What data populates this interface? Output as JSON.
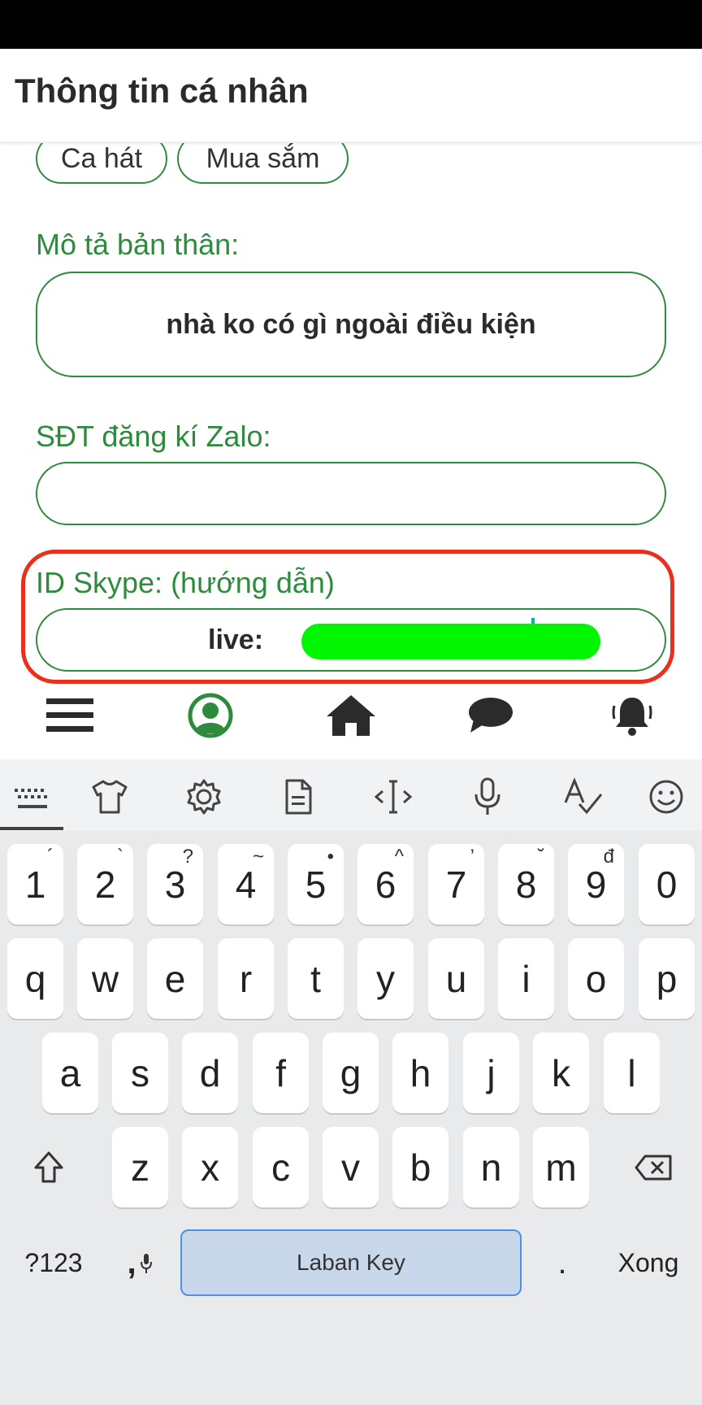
{
  "header": {
    "title": "Thông tin cá nhân"
  },
  "interests": {
    "chips": [
      "Ca hát",
      "Mua sắm"
    ]
  },
  "description": {
    "label": "Mô tả bản thân:",
    "value": "nhà ko có gì ngoài điều kiện"
  },
  "zalo": {
    "label": "SĐT đăng kí Zalo:",
    "value": ""
  },
  "skype": {
    "label": "ID Skype: ",
    "help_link": "(hướng dẫn)",
    "value_prefix": "live:"
  },
  "colors": {
    "accent": "#2e8b3d",
    "highlight": "#e8301c",
    "redaction": "#00f500",
    "spacebar": "#c9d7ea"
  },
  "bottom_nav": [
    {
      "icon": "menu-icon"
    },
    {
      "icon": "profile-icon",
      "active": true
    },
    {
      "icon": "home-icon"
    },
    {
      "icon": "chat-icon"
    },
    {
      "icon": "bell-icon"
    }
  ],
  "keyboard": {
    "toolbar": [
      "keyboard-icon",
      "shirt-icon",
      "gear-icon",
      "clipboard-icon",
      "cursor-move-icon",
      "mic-icon",
      "spellcheck-icon",
      "emoji-icon"
    ],
    "number_row": [
      {
        "key": "1",
        "hint": "´"
      },
      {
        "key": "2",
        "hint": "`"
      },
      {
        "key": "3",
        "hint": "?"
      },
      {
        "key": "4",
        "hint": "~"
      },
      {
        "key": "5",
        "hint": "•"
      },
      {
        "key": "6",
        "hint": "^"
      },
      {
        "key": "7",
        "hint": "’"
      },
      {
        "key": "8",
        "hint": "˘"
      },
      {
        "key": "9",
        "hint": "đ"
      },
      {
        "key": "0",
        "hint": ""
      }
    ],
    "row1": [
      "q",
      "w",
      "e",
      "r",
      "t",
      "y",
      "u",
      "i",
      "o",
      "p"
    ],
    "row2": [
      "a",
      "s",
      "d",
      "f",
      "g",
      "h",
      "j",
      "k",
      "l"
    ],
    "row3": [
      "z",
      "x",
      "c",
      "v",
      "b",
      "n",
      "m"
    ],
    "symbols_label": "?123",
    "comma_label": ",",
    "space_label": "Laban Key",
    "period_label": ".",
    "done_label": "Xong"
  }
}
